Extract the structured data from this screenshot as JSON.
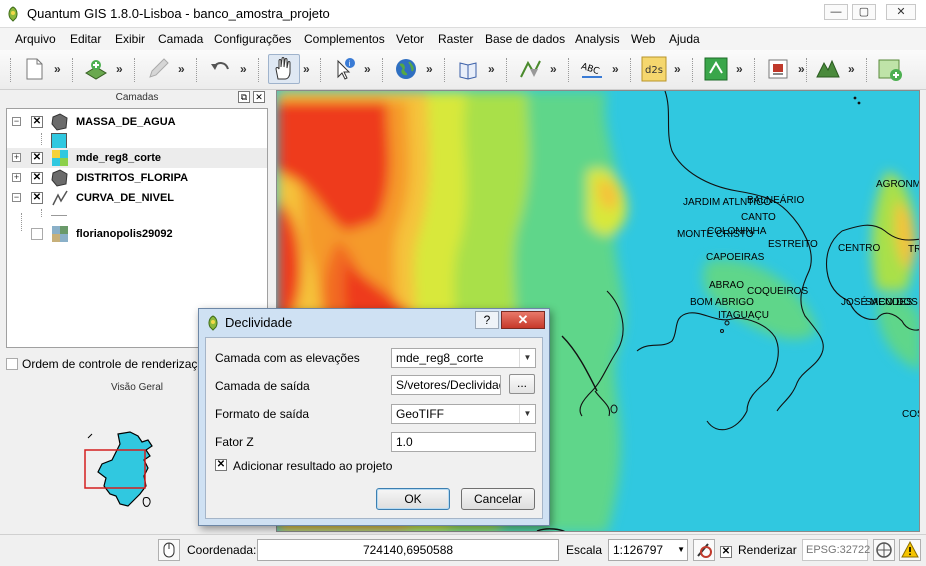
{
  "window": {
    "title": "Quantum GIS 1.8.0-Lisboa - banco_amostra_projeto",
    "minimize_glyph": "—",
    "maximize_glyph": "▢",
    "close_glyph": "✕"
  },
  "menu": [
    "Arquivo",
    "Editar",
    "Exibir",
    "Camada",
    "Configurações",
    "Complementos",
    "Vetor",
    "Raster",
    "Base de dados",
    "Analysis",
    "Web",
    "Ajuda"
  ],
  "toolbar": {
    "more_glyph": "»",
    "abc_label": "ABC",
    "d2s_label": "d2s"
  },
  "layers_panel": {
    "title": "Camadas",
    "float_glyph": "⧉",
    "close_glyph": "✕",
    "layers": [
      {
        "name": "MASSA_DE_AGUA",
        "checked": true,
        "expanded": true,
        "icon": "polygon-layer-icon"
      },
      {
        "name": "mde_reg8_corte",
        "checked": true,
        "expanded": false,
        "icon": "raster-layer-icon"
      },
      {
        "name": "DISTRITOS_FLORIPA",
        "checked": true,
        "expanded": false,
        "icon": "polygon-layer-icon"
      },
      {
        "name": "CURVA_DE_NIVEL",
        "checked": true,
        "expanded": true,
        "icon": "line-layer-icon"
      },
      {
        "name": "florianopolis29092",
        "checked": false,
        "expanded": false,
        "icon": "raster-layer-icon"
      }
    ],
    "render_order_label": "Ordem de controle de renderização"
  },
  "overview_panel": {
    "title": "Visão Geral"
  },
  "map": {
    "labels": [
      "JARDIM ATLNTICO",
      "BALNEÁRIO",
      "CANTO",
      "MONTE CRISTO",
      "COLONINHA",
      "ESTREITO",
      "CAPOEIRAS",
      "CENTRO",
      "ABRAO",
      "COQUEIROS",
      "BOM ABRIGO",
      "ITAGUAÇU",
      "JOSÉ MENDES",
      "AGRONMI",
      "SACO DOS L",
      "TR",
      "COS"
    ]
  },
  "dialog": {
    "title": "Declividade",
    "help_glyph": "?",
    "close_glyph": "✕",
    "elevation_layer_label": "Camada com as elevações",
    "elevation_layer_value": "mde_reg8_corte",
    "output_layer_label": "Camada de saída",
    "output_layer_value": "S/vetores/Declividade",
    "browse_label": "...",
    "output_format_label": "Formato de saída",
    "output_format_value": "GeoTIFF",
    "z_factor_label": "Fator Z",
    "z_factor_value": "1.0",
    "add_result_label": "Adicionar resultado ao projeto",
    "add_result_checked": true,
    "ok_label": "OK",
    "cancel_label": "Cancelar"
  },
  "statusbar": {
    "coordinate_label": "Coordenada:",
    "coordinate_value": "724140,6950588",
    "scale_label": "Escala",
    "scale_value": "1:126797",
    "render_label": "Renderizar",
    "render_checked": true,
    "crs_value": "EPSG:32722"
  },
  "colors": {
    "water": "#30c8e0",
    "selection_red": "#d41f1f",
    "dialog_frame": "#cfe1f3"
  }
}
